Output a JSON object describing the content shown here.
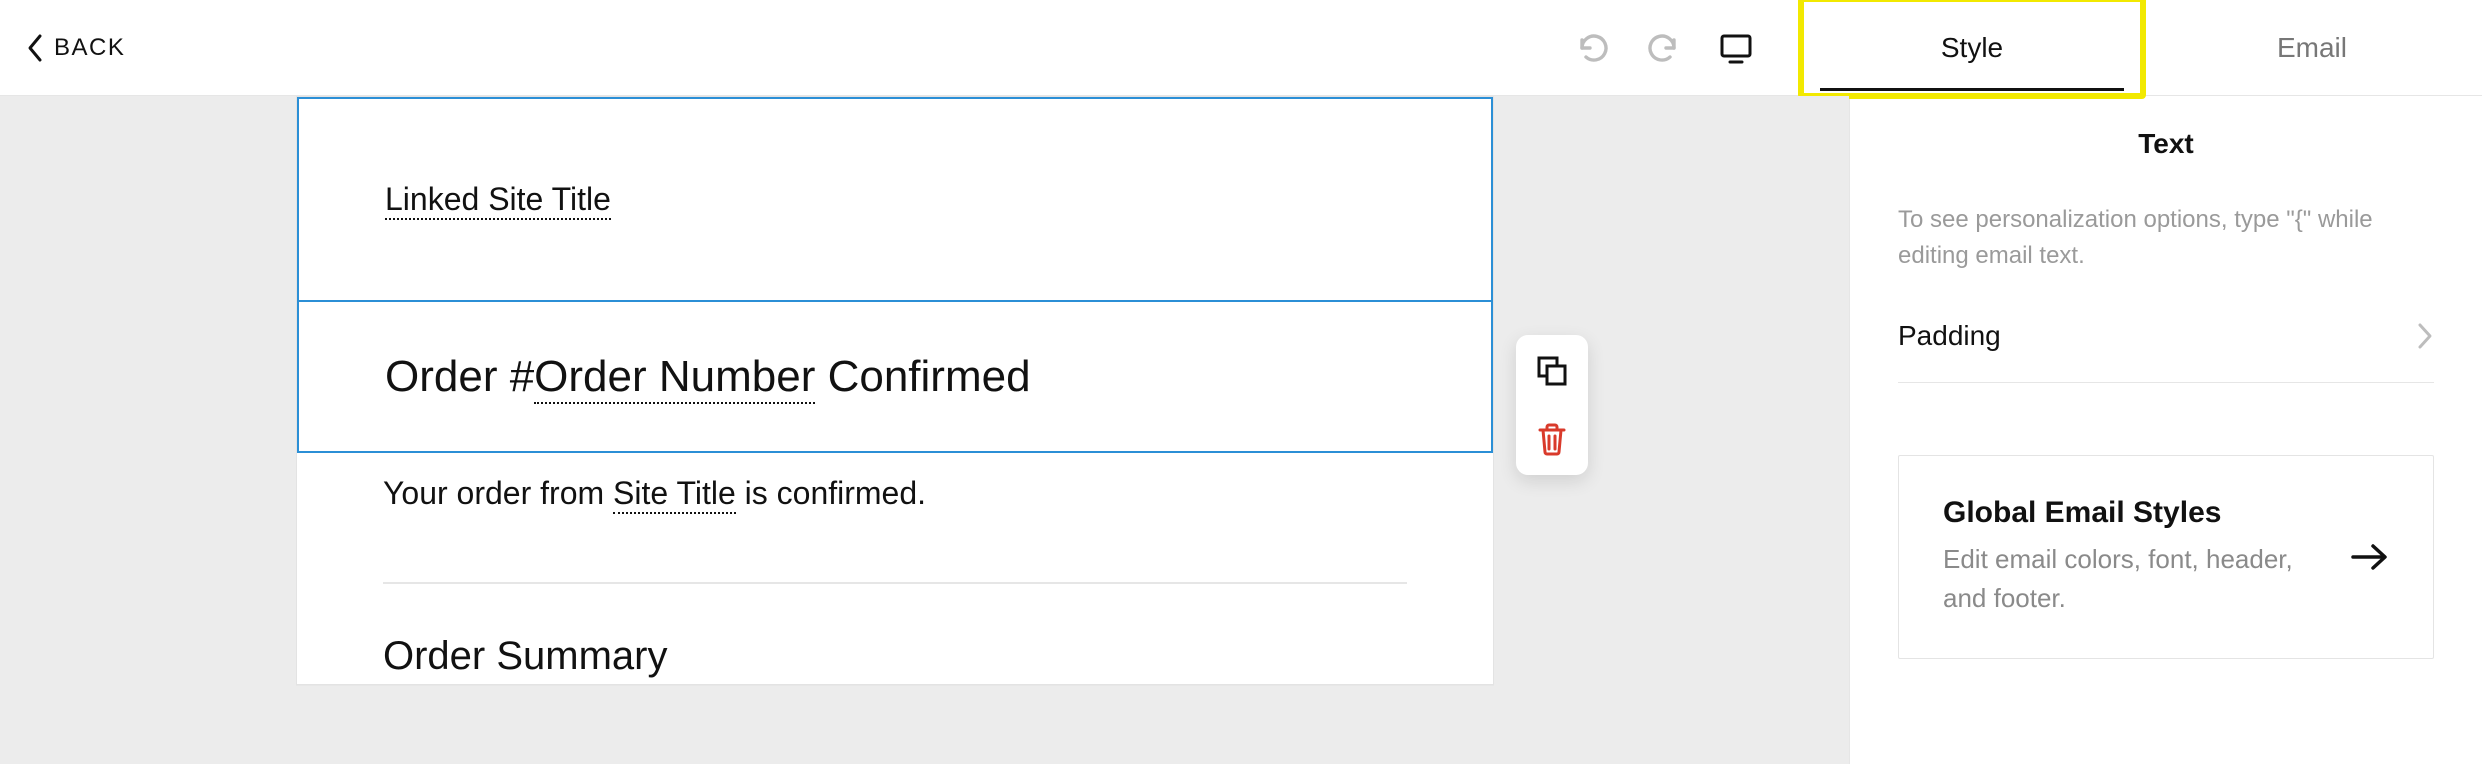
{
  "topbar": {
    "back_label": "BACK",
    "tabs": {
      "style": "Style",
      "email": "Email"
    }
  },
  "email": {
    "linked_site_title": "Linked Site Title",
    "order_heading_prefix": "Order #",
    "order_number_tag": "Order Number",
    "order_heading_suffix": " Confirmed",
    "body_prefix": "Your order from ",
    "site_title_tag": "Site Title",
    "body_suffix": " is confirmed.",
    "order_summary": "Order Summary"
  },
  "sidebar": {
    "heading": "Text",
    "hint": "To see personalization options, type \"{\" while editing email text.",
    "padding_label": "Padding",
    "global_card": {
      "title": "Global Email Styles",
      "subtitle": "Edit email colors, font, header, and footer."
    }
  }
}
